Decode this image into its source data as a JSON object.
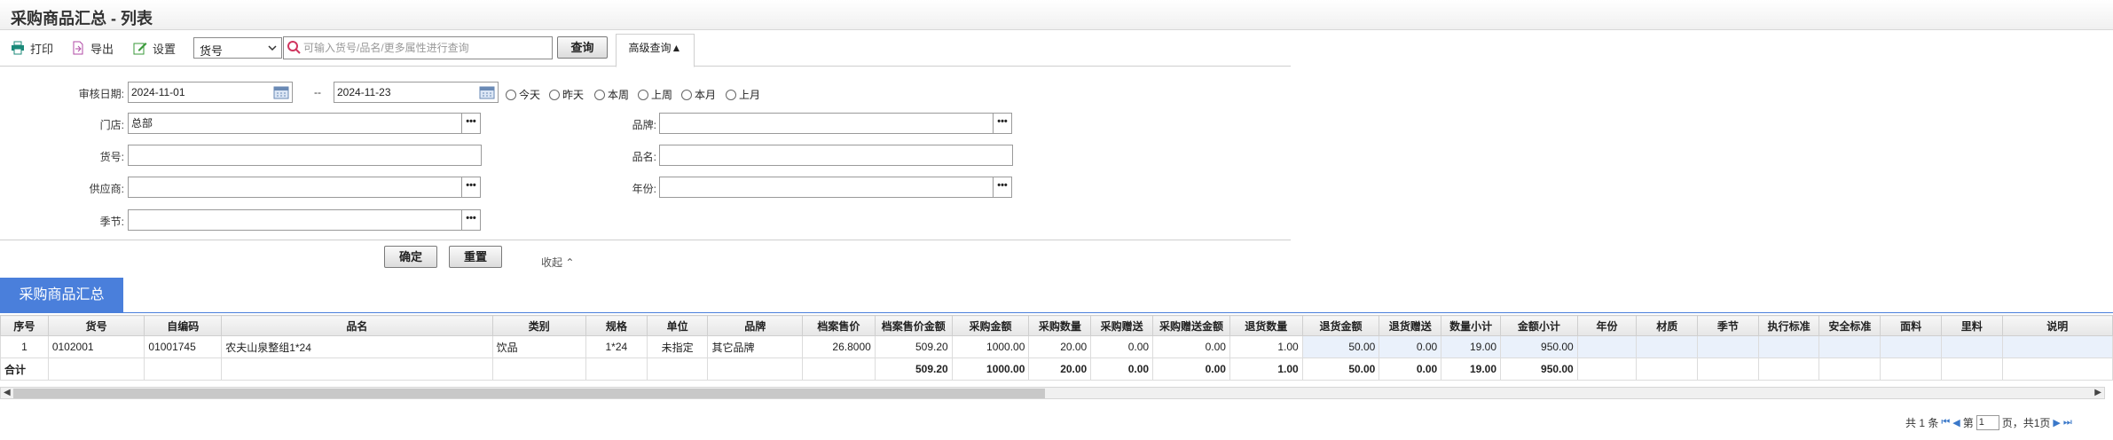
{
  "title": "采购商品汇总 - 列表",
  "toolbar": {
    "print_label": "打印",
    "export_label": "导出",
    "settings_label": "设置",
    "field_select": "货号",
    "search_placeholder": "可输入货号/品名/更多属性进行查询",
    "query_label": "查询",
    "advanced_label": "高级查询▲"
  },
  "filters": {
    "audit_date_label": "审核日期:",
    "date_from": "2024-11-01",
    "date_sep": "--",
    "date_to": "2024-11-23",
    "quick_ranges": [
      "今天",
      "昨天",
      "本周",
      "上周",
      "本月",
      "上月"
    ],
    "store_label": "门店:",
    "store_value": "总部",
    "sku_label": "货号:",
    "supplier_label": "供应商:",
    "season_label": "季节:",
    "brand_label": "品牌:",
    "name_label": "品名:",
    "year_label": "年份:",
    "ellipsis": "•••",
    "confirm_label": "确定",
    "reset_label": "重置",
    "collapse_label": "收起 ⌃"
  },
  "panel": {
    "tab_label": "采购商品汇总"
  },
  "grid": {
    "columns": [
      "序号",
      "货号",
      "自编码",
      "品名",
      "类别",
      "规格",
      "单位",
      "品牌",
      "档案售价",
      "档案售价金额",
      "采购金额",
      "采购数量",
      "采购赠送",
      "采购赠送金额",
      "退货数量",
      "退货金额",
      "退货赠送",
      "数量小计",
      "金额小计",
      "年份",
      "材质",
      "季节",
      "执行标准",
      "安全标准",
      "面料",
      "里料",
      "说明"
    ],
    "rows": [
      [
        "1",
        "0102001",
        "01001745",
        "农夫山泉整组1*24",
        "饮品",
        "1*24",
        "未指定",
        "其它品牌",
        "26.8000",
        "509.20",
        "1000.00",
        "20.00",
        "0.00",
        "0.00",
        "1.00",
        "50.00",
        "0.00",
        "19.00",
        "950.00",
        "",
        "",
        "",
        "",
        "",
        "",
        "",
        ""
      ]
    ],
    "summary": [
      "合计",
      "",
      "",
      "",
      "",
      "",
      "",
      "",
      "",
      "509.20",
      "1000.00",
      "20.00",
      "0.00",
      "0.00",
      "1.00",
      "50.00",
      "0.00",
      "19.00",
      "950.00",
      "",
      "",
      "",
      "",
      "",
      "",
      "",
      ""
    ]
  },
  "pager": {
    "total_text": "共 1 条",
    "page_prefix": "第",
    "page_value": "1",
    "page_suffix": "页，共1页"
  },
  "colors": {
    "accent": "#4a7fdb",
    "row_highlight": "#eaf1fb"
  }
}
